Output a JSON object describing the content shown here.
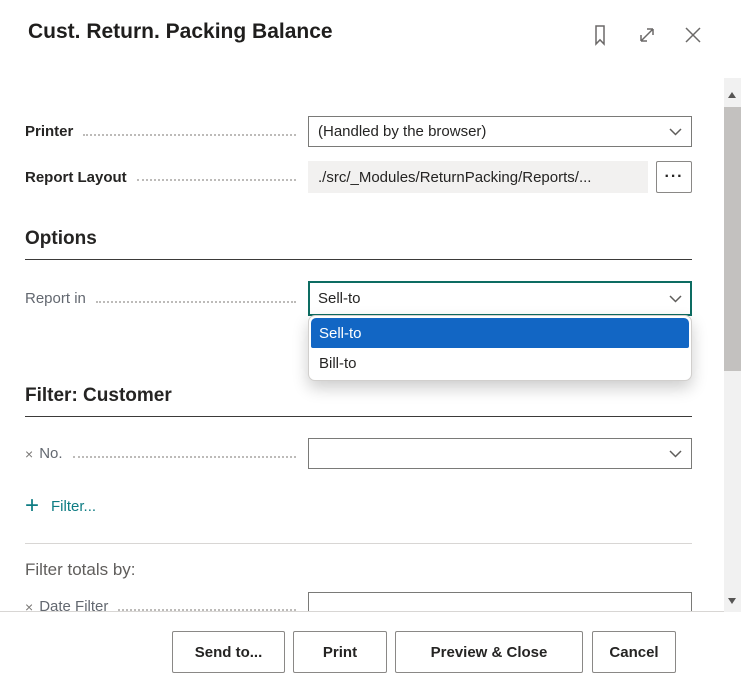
{
  "header": {
    "title": "Cust. Return. Packing Balance",
    "icons": [
      "bookmark-icon",
      "expand-icon",
      "close-icon"
    ]
  },
  "printer": {
    "label": "Printer",
    "value": "(Handled by the browser)"
  },
  "report_layout": {
    "label": "Report Layout",
    "value": "./src/_Modules/ReturnPacking/Reports/...",
    "assist_button": "···"
  },
  "options_section": {
    "title": "Options"
  },
  "report_in": {
    "label": "Report in",
    "value": "Sell-to",
    "options": [
      "Sell-to",
      "Bill-to"
    ],
    "selected_index": 0
  },
  "filter_customer_section": {
    "title": "Filter: Customer",
    "no_label": "No.",
    "no_value": "",
    "remove_glyph": "×",
    "plus_glyph": "+",
    "add_filter": "Filter..."
  },
  "filter_totals": {
    "title": "Filter totals by:",
    "date_filter_label": "Date Filter",
    "date_filter_value": ""
  },
  "footer": {
    "buttons": [
      "Send to...",
      "Print",
      "Preview & Close",
      "Cancel"
    ]
  },
  "colors": {
    "accent_teal": "#0e7c83",
    "focus_border": "#0d6c62",
    "selection_blue": "#1266c4",
    "readonly_field_bg": "#f2f1f0"
  }
}
